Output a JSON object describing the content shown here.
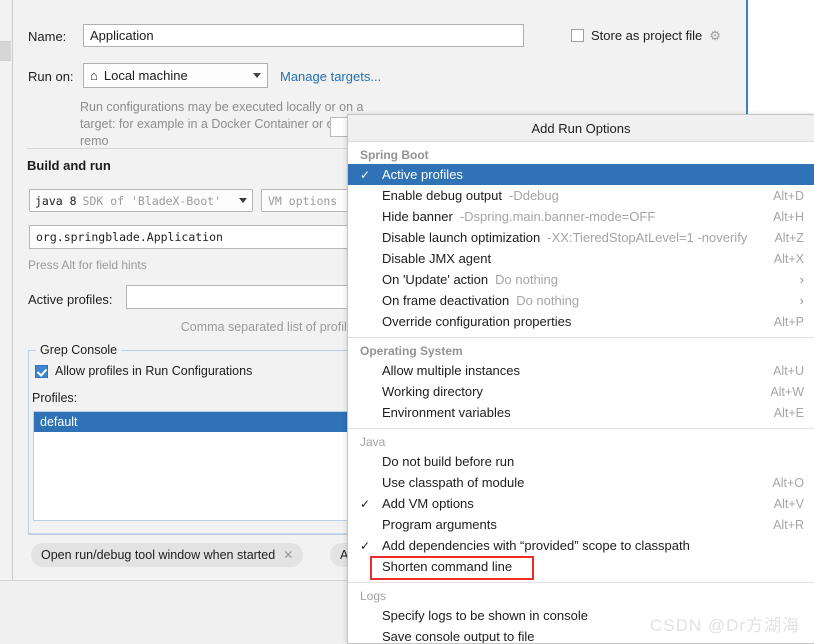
{
  "dialog": {
    "name_label": "Name:",
    "name_value": "Application",
    "store_as_project_file": "Store as project file",
    "gear_icon": "gear-icon",
    "run_on_label": "Run on:",
    "run_on_value": "Local machine",
    "home_icon": "home-icon",
    "manage_targets_link": "Manage targets...",
    "run_hint": "Run configurations may be executed locally or on a target: for example in a Docker Container or on a remo",
    "build_and_run_header": "Build and run",
    "sdk_primary": "java 8",
    "sdk_secondary": "SDK of 'BladeX-Boot'",
    "vm_options_placeholder": "VM options",
    "main_class_value": "org.springblade.Application",
    "field_hint": "Press Alt for field hints",
    "active_profiles_label": "Active profiles:",
    "active_profiles_value": "",
    "comma_hint": "Comma separated list of profiles",
    "grep": {
      "group_title": "Grep Console",
      "allow_profiles_label": "Allow profiles in Run Configurations",
      "allow_profiles_checked": true,
      "profiles_label": "Profiles:",
      "list_items": [
        "default"
      ],
      "selected_item": "default"
    },
    "chips": [
      {
        "label": "Open run/debug tool window when started",
        "close_icon": "close-icon"
      },
      {
        "label": "A"
      }
    ]
  },
  "menu": {
    "title": "Add Run Options",
    "accent_selected": "#2f72b6",
    "highlight_color": "#ee2b2b",
    "groups": [
      {
        "section": "Spring Boot",
        "section_bold": true,
        "items": [
          {
            "check": "✓",
            "label": "Active profiles",
            "value": "",
            "shortcut": "",
            "submenu": "",
            "selected": true
          },
          {
            "check": "",
            "label": "Enable debug output",
            "value": "-Ddebug",
            "shortcut": "Alt+D",
            "submenu": "",
            "selected": false
          },
          {
            "check": "",
            "label": "Hide banner",
            "value": "-Dspring.main.banner-mode=OFF",
            "shortcut": "Alt+H",
            "submenu": "",
            "selected": false
          },
          {
            "check": "",
            "label": "Disable launch optimization",
            "value": "-XX:TieredStopAtLevel=1 -noverify",
            "shortcut": "Alt+Z",
            "submenu": "",
            "selected": false
          },
          {
            "check": "",
            "label": "Disable JMX agent",
            "value": "",
            "shortcut": "Alt+X",
            "submenu": "",
            "selected": false
          },
          {
            "check": "",
            "label": "On 'Update' action",
            "value": "Do nothing",
            "shortcut": "",
            "submenu": "›",
            "selected": false
          },
          {
            "check": "",
            "label": "On frame deactivation",
            "value": "Do nothing",
            "shortcut": "",
            "submenu": "›",
            "selected": false
          },
          {
            "check": "",
            "label": "Override configuration properties",
            "value": "",
            "shortcut": "Alt+P",
            "submenu": "",
            "selected": false
          }
        ]
      },
      {
        "section": "Operating System",
        "section_bold": true,
        "items": [
          {
            "check": "",
            "label": "Allow multiple instances",
            "value": "",
            "shortcut": "Alt+U",
            "submenu": "",
            "selected": false
          },
          {
            "check": "",
            "label": "Working directory",
            "value": "",
            "shortcut": "Alt+W",
            "submenu": "",
            "selected": false
          },
          {
            "check": "",
            "label": "Environment variables",
            "value": "",
            "shortcut": "Alt+E",
            "submenu": "",
            "selected": false
          }
        ]
      },
      {
        "section": "Java",
        "section_bold": false,
        "items": [
          {
            "check": "",
            "label": "Do not build before run",
            "value": "",
            "shortcut": "",
            "submenu": "",
            "selected": false
          },
          {
            "check": "",
            "label": "Use classpath of module",
            "value": "",
            "shortcut": "Alt+O",
            "submenu": "",
            "selected": false
          },
          {
            "check": "✓",
            "label": "Add VM options",
            "value": "",
            "shortcut": "Alt+V",
            "submenu": "",
            "selected": false
          },
          {
            "check": "",
            "label": "Program arguments",
            "value": "",
            "shortcut": "Alt+R",
            "submenu": "",
            "selected": false
          },
          {
            "check": "✓",
            "label": "Add dependencies with “provided” scope to classpath",
            "value": "",
            "shortcut": "",
            "submenu": "",
            "selected": false
          },
          {
            "check": "",
            "label": "Shorten command line",
            "value": "",
            "shortcut": "",
            "submenu": "",
            "selected": false,
            "highlighted": true
          }
        ]
      },
      {
        "section": "Logs",
        "section_bold": false,
        "items": [
          {
            "check": "",
            "label": "Specify logs to be shown in console",
            "value": "",
            "shortcut": "",
            "submenu": "",
            "selected": false
          },
          {
            "check": "",
            "label": "Save console output to file",
            "value": "",
            "shortcut": "",
            "submenu": "",
            "selected": false
          }
        ]
      }
    ]
  },
  "watermark": "CSDN @Dr方湖海"
}
